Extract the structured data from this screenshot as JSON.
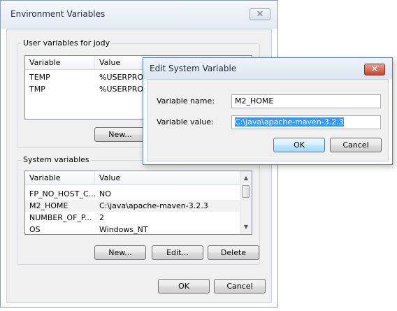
{
  "env_window": {
    "title": "Environment Variables",
    "user_group": {
      "title": "User variables for jody",
      "col_variable": "Variable",
      "col_value": "Value",
      "rows": [
        {
          "name": "TEMP",
          "value": "%USERPROFILE%\\AppData\\Local\\Temp"
        },
        {
          "name": "TMP",
          "value": "%USERPROFILE%\\AppData\\Local\\Temp"
        }
      ],
      "new_label": "New..."
    },
    "system_group": {
      "title": "System variables",
      "col_variable": "Variable",
      "col_value": "Value",
      "rows": [
        {
          "name": "FP_NO_HOST_C...",
          "value": "NO"
        },
        {
          "name": "M2_HOME",
          "value": "C:\\java\\apache-maven-3.2.3"
        },
        {
          "name": "NUMBER_OF_P...",
          "value": "2"
        },
        {
          "name": "OS",
          "value": "Windows_NT"
        }
      ],
      "new_label": "New...",
      "edit_label": "Edit...",
      "delete_label": "Delete"
    },
    "ok_label": "OK",
    "cancel_label": "Cancel"
  },
  "edit_dialog": {
    "title": "Edit System Variable",
    "name_label": "Variable name:",
    "name_value": "M2_HOME",
    "value_label": "Variable value:",
    "value_value": "C:\\java\\apache-maven-3.2.3",
    "ok_label": "OK",
    "cancel_label": "Cancel"
  },
  "icons": {
    "close": "close-icon",
    "scroll_up": "scroll-up-arrow-icon",
    "scroll_down": "scroll-down-arrow-icon"
  },
  "colors": {
    "selection": "#3399ff",
    "default_button": "#bee6fd",
    "close_red": "#c7432b"
  }
}
